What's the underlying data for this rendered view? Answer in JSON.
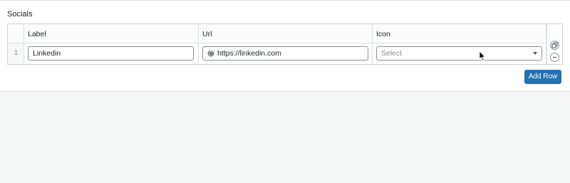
{
  "field": {
    "label": "Socials"
  },
  "table": {
    "columns": [
      {
        "label": "Label"
      },
      {
        "label": "Url"
      },
      {
        "label": "Icon"
      }
    ],
    "rows": [
      {
        "index": "1",
        "label_value": "Linkedin",
        "url_value": "https://linkedin.com",
        "icon_select": {
          "selected": "Select",
          "placeholder": true
        }
      }
    ]
  },
  "actions": {
    "add_row_label": "Add Row"
  },
  "icons": {
    "url_prefix": "globe-icon",
    "duplicate": "duplicate-icon",
    "remove": "minus-icon",
    "select_caret": "chevron-down-icon"
  },
  "colors": {
    "accent": "#2271b1",
    "border": "#8c8f94",
    "placeholder": "#8c8f94"
  }
}
